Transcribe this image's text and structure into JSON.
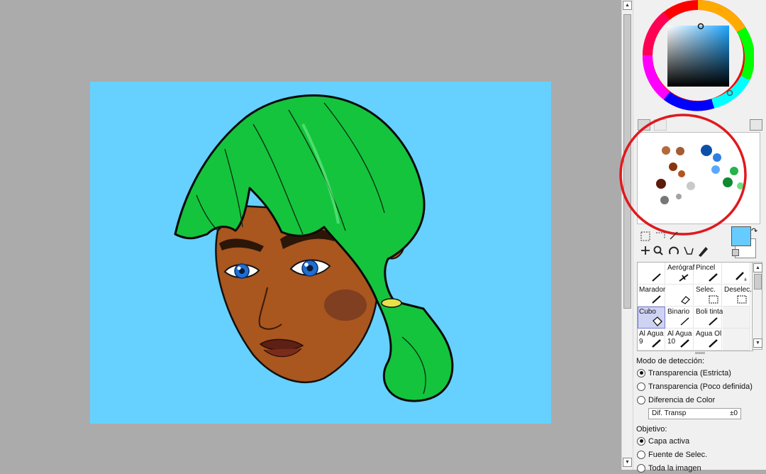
{
  "canvas": {
    "background_color": "#ababab",
    "artwork_background": "#66d1ff"
  },
  "color_wheel": {
    "name": "hsv-color-wheel"
  },
  "palette_swatches": [
    "#b5693a",
    "#a35c33",
    "#8a3410",
    "#5e1a0a",
    "#b4541f",
    "#c9c9c9",
    "#a3a3a3",
    "#777777",
    "#0a50a8",
    "#2e7fe0",
    "#5aa9ff",
    "#25b34a",
    "#0e8a2f",
    "#69e07f"
  ],
  "colors": {
    "primary": "#66ccff",
    "secondary": "#ffffff"
  },
  "brushes": [
    {
      "label": "",
      "icon": "pen-icon"
    },
    {
      "label": "Aerógraf",
      "icon": "airbrush-icon"
    },
    {
      "label": "Pincel",
      "icon": "brush-icon"
    },
    {
      "label": "",
      "icon": "water-brush-icon"
    },
    {
      "label": "Marador",
      "icon": "marker-icon"
    },
    {
      "label": "",
      "icon": "eraser-icon"
    },
    {
      "label": "Selec.",
      "icon": "select-brush-icon"
    },
    {
      "label": "Deselec.",
      "icon": "deselect-brush-icon"
    },
    {
      "label": "Cubo",
      "icon": "bucket-icon"
    },
    {
      "label": "Binario",
      "icon": "binary-pen-icon"
    },
    {
      "label": "Boli tinta",
      "icon": "ink-pen-icon"
    },
    {
      "label": "",
      "icon": ""
    },
    {
      "label": "Al Agua\n9",
      "icon": "water9-icon"
    },
    {
      "label": "Al Agua\n10",
      "icon": "water10-icon"
    },
    {
      "label": "Agua Ol",
      "icon": "water-oil-icon"
    },
    {
      "label": "",
      "icon": ""
    }
  ],
  "detection": {
    "title": "Modo de detección:",
    "options": [
      "Transparencia (Estricta)",
      "Transparencia (Poco definida)",
      "Diferencia de Color"
    ],
    "selected": 0
  },
  "transp_field": {
    "label": "Dif. Transp",
    "value": "±0"
  },
  "target": {
    "title": "Objetivo:",
    "options": [
      "Capa activa",
      "Fuente de Selec.",
      "Toda la imagen"
    ],
    "selected": 0
  }
}
